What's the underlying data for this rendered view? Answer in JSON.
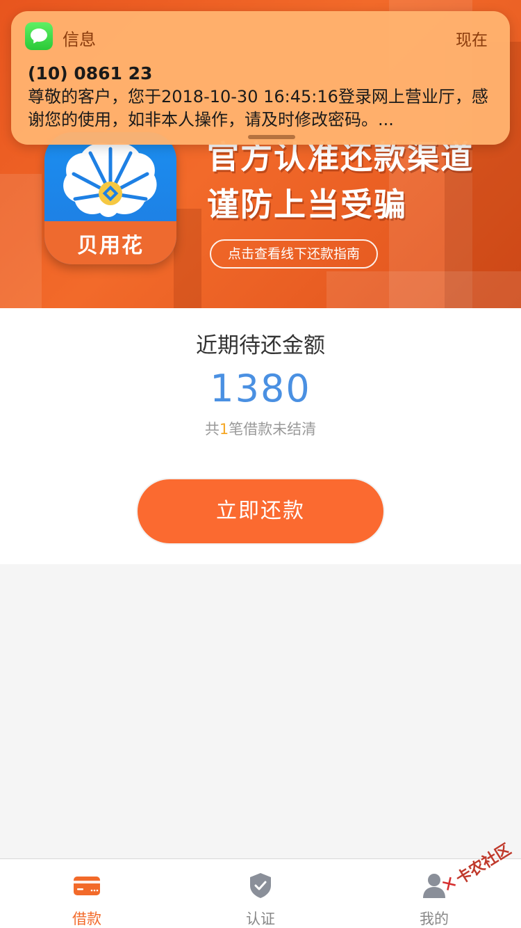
{
  "notification": {
    "app_name": "信息",
    "time": "现在",
    "sender": "(10) 0861 23",
    "body": "尊敬的客户，您于2018-10-30 16:45:16登录网上营业厅，感谢您的使用，如非本人操作，请及时修改密码。...",
    "icon": "messages-icon"
  },
  "banner": {
    "app_icon_label": "贝用花",
    "slogan_line1": "官方认准还款渠道",
    "slogan_line2": "谨防上当受骗",
    "guide_button": "点击查看线下还款指南"
  },
  "repayment": {
    "title": "近期待还金额",
    "amount": "1380",
    "sub_prefix": "共",
    "sub_count": "1",
    "sub_suffix": "笔借款未结清",
    "button": "立即还款"
  },
  "tabs": [
    {
      "label": "借款",
      "icon": "card-icon",
      "active": true
    },
    {
      "label": "认证",
      "icon": "shield-check-icon",
      "active": false
    },
    {
      "label": "我的",
      "icon": "person-icon",
      "active": false
    }
  ],
  "watermark": "卡农社区",
  "colors": {
    "accent": "#f26a2a",
    "amount": "#4a90e2",
    "count_highlight": "#f5a623",
    "notification_bg": "#ffb26e"
  }
}
